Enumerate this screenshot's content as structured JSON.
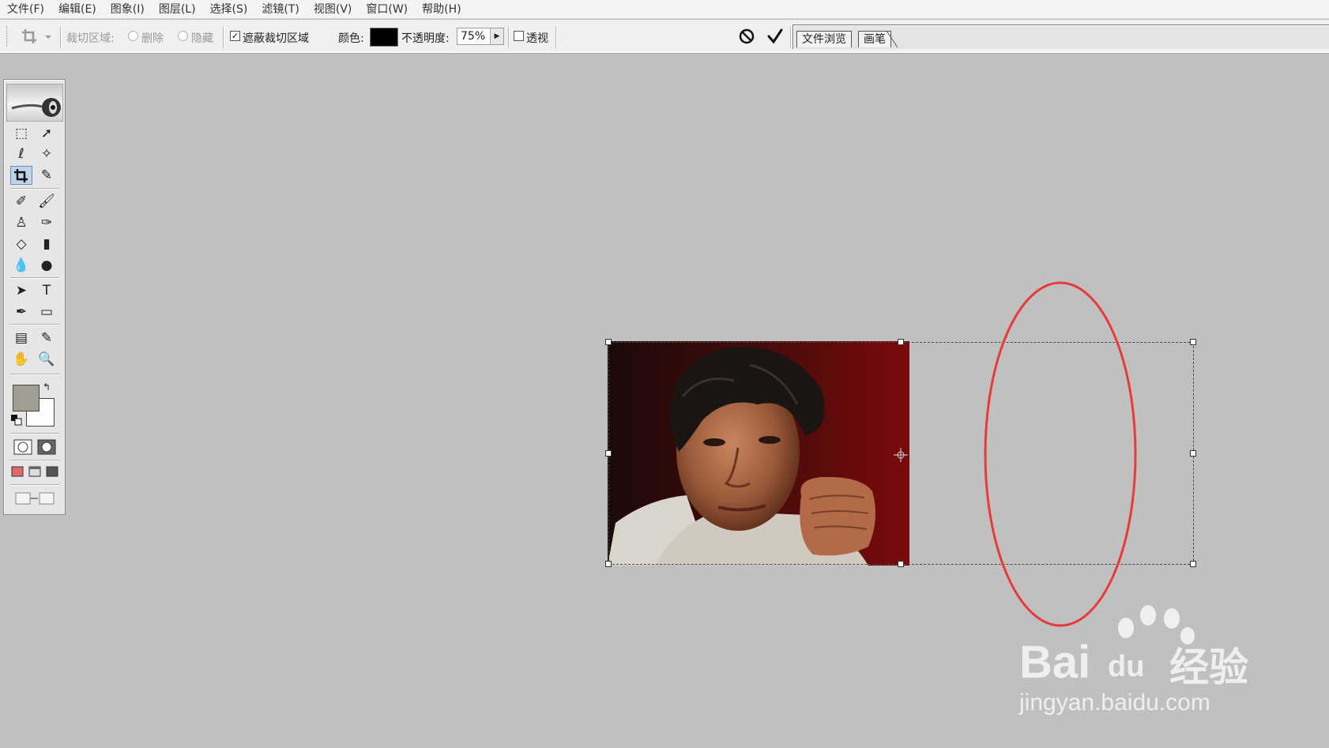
{
  "menu": [
    "文件(F)",
    "编辑(E)",
    "图象(I)",
    "图层(L)",
    "选择(S)",
    "滤镜(T)",
    "视图(V)",
    "窗口(W)",
    "帮助(H)"
  ],
  "options": {
    "crop_area_label": "裁切区域:",
    "delete_label": "删除",
    "hide_label": "隐藏",
    "shield_label": "遮蔽裁切区域",
    "shield_checked": true,
    "color_label": "颜色:",
    "shield_color": "#000000",
    "opacity_label": "不透明度:",
    "opacity_value": "75%",
    "perspective_label": "透视",
    "perspective_checked": false,
    "cancel_icon": "cancel-circle-icon",
    "commit_icon": "checkmark-icon"
  },
  "palette_tabs": [
    "文件浏览",
    "画笔"
  ],
  "toolbox": {
    "active_tool": "crop",
    "foreground_color": "#a19e94",
    "background_color": "#ffffff"
  },
  "annotation_color": "#e83a3a",
  "watermark": {
    "logo_text": "Bai",
    "logo_du": "du",
    "logo_cn": "经验",
    "url": "jingyan.baidu.com"
  }
}
